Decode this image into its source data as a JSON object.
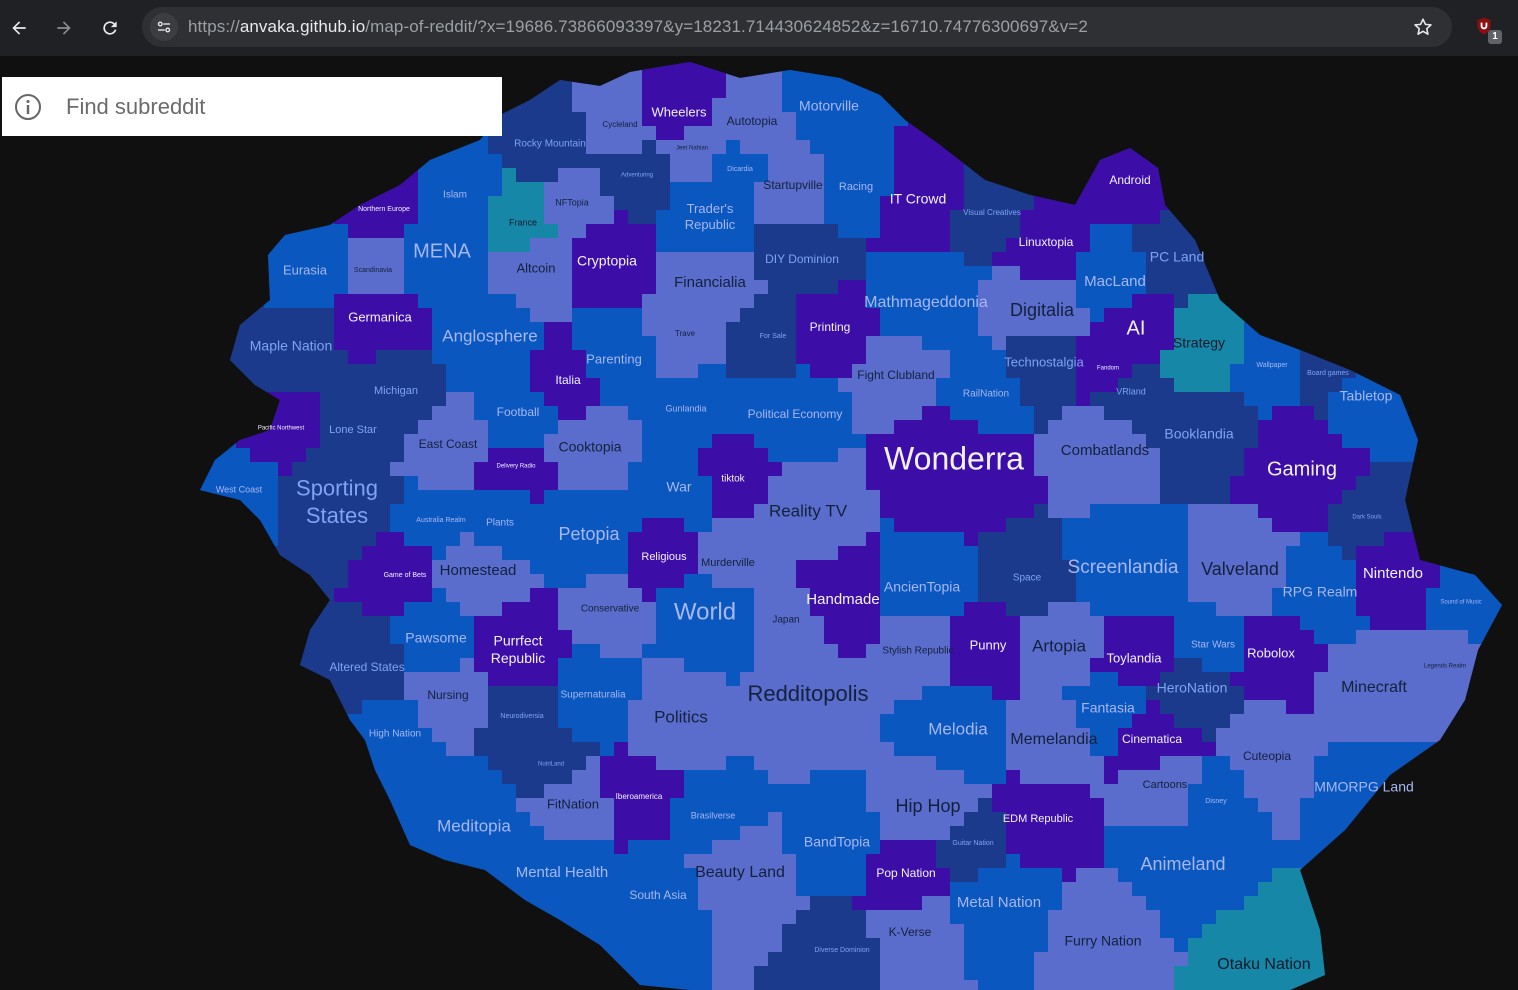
{
  "browser": {
    "url_scheme": "https://",
    "url_host": "anvaka.github.io",
    "url_path": "/map-of-reddit/?x=19686.73866093397&y=18231.714430624852&z=16710.74776300697&v=2",
    "extension_badge": "1",
    "icons": [
      "back-arrow-icon",
      "forward-arrow-icon",
      "reload-icon",
      "site-settings-icon",
      "bookmark-star-icon",
      "ublock-extension-icon"
    ]
  },
  "search": {
    "placeholder": "Find subreddit",
    "icon": "info-icon"
  },
  "colors": {
    "background": "#101010",
    "region_shades": [
      "#1b3a8c",
      "#0b57c0",
      "#5a6dcc",
      "#3d0da8",
      "#1787a8"
    ]
  },
  "regions": [
    {
      "name": "Wheelers"
    },
    {
      "name": "Autotopia"
    },
    {
      "name": "Motorville"
    },
    {
      "name": "Cycleland"
    },
    {
      "name": "Rocky Mountain"
    },
    {
      "name": "Jeet Nahian"
    },
    {
      "name": "Dicardia"
    },
    {
      "name": "Adventuring"
    },
    {
      "name": "Startupville"
    },
    {
      "name": "Racing"
    },
    {
      "name": "IT Crowd"
    },
    {
      "name": "Visual Creatives"
    },
    {
      "name": "Android"
    },
    {
      "name": "Islam"
    },
    {
      "name": "Northern Europe"
    },
    {
      "name": "NFTopia"
    },
    {
      "name": "France"
    },
    {
      "name": "Trader's Republic"
    },
    {
      "name": "MENA"
    },
    {
      "name": "Cryptopia"
    },
    {
      "name": "DIY Dominion"
    },
    {
      "name": "Linuxtopia"
    },
    {
      "name": "PC Land"
    },
    {
      "name": "Eurasia"
    },
    {
      "name": "Scandinavia"
    },
    {
      "name": "Altcoin"
    },
    {
      "name": "Financialia"
    },
    {
      "name": "MacLand"
    },
    {
      "name": "Mathmageddonia"
    },
    {
      "name": "Digitalia"
    },
    {
      "name": "AI"
    },
    {
      "name": "Strategy"
    },
    {
      "name": "Germanica"
    },
    {
      "name": "Anglosphere"
    },
    {
      "name": "Maple Nation"
    },
    {
      "name": "Trave"
    },
    {
      "name": "For Sale"
    },
    {
      "name": "Printing"
    },
    {
      "name": "Parenting"
    },
    {
      "name": "Technostalgia"
    },
    {
      "name": "Fandom"
    },
    {
      "name": "Wallpaper"
    },
    {
      "name": "Board games"
    },
    {
      "name": "Italia"
    },
    {
      "name": "Fight Clubland"
    },
    {
      "name": "RailNation"
    },
    {
      "name": "VRland"
    },
    {
      "name": "Tabletop"
    },
    {
      "name": "Michigan"
    },
    {
      "name": "Gunlandia"
    },
    {
      "name": "Football"
    },
    {
      "name": "Political Economy"
    },
    {
      "name": "Booklandia"
    },
    {
      "name": "Pacific Northwest"
    },
    {
      "name": "Lone Star"
    },
    {
      "name": "East Coast"
    },
    {
      "name": "Cooktopia"
    },
    {
      "name": "Wonderra"
    },
    {
      "name": "Combatlands"
    },
    {
      "name": "Gaming"
    },
    {
      "name": "Delivery Radio"
    },
    {
      "name": "tiktok"
    },
    {
      "name": "War"
    },
    {
      "name": "West Coast"
    },
    {
      "name": "Sporting States"
    },
    {
      "name": "Australia Realm"
    },
    {
      "name": "Plants"
    },
    {
      "name": "Reality TV"
    },
    {
      "name": "Dark Souls"
    },
    {
      "name": "Petopia"
    },
    {
      "name": "Religious"
    },
    {
      "name": "Murderville"
    },
    {
      "name": "Space"
    },
    {
      "name": "Game of Bets"
    },
    {
      "name": "Homestead"
    },
    {
      "name": "Screenlandia"
    },
    {
      "name": "Valveland"
    },
    {
      "name": "Nintendo"
    },
    {
      "name": "AncienTopia"
    },
    {
      "name": "Handmade"
    },
    {
      "name": "RPG Realm"
    },
    {
      "name": "Conservative"
    },
    {
      "name": "World"
    },
    {
      "name": "Japan"
    },
    {
      "name": "Pawsome"
    },
    {
      "name": "Purrfect Republic"
    },
    {
      "name": "Stylish Republic"
    },
    {
      "name": "Punny"
    },
    {
      "name": "Artopia"
    },
    {
      "name": "Toylandia"
    },
    {
      "name": "Star Wars"
    },
    {
      "name": "Robolox"
    },
    {
      "name": "Altered States"
    },
    {
      "name": "Nursing"
    },
    {
      "name": "Supernaturalia"
    },
    {
      "name": "Redditopolis"
    },
    {
      "name": "HeroNation"
    },
    {
      "name": "Fantasia"
    },
    {
      "name": "Minecraft"
    },
    {
      "name": "Politics"
    },
    {
      "name": "Neurodiversia"
    },
    {
      "name": "High Nation"
    },
    {
      "name": "Melodia"
    },
    {
      "name": "Memelandia"
    },
    {
      "name": "Cinematica"
    },
    {
      "name": "Cuteopia"
    },
    {
      "name": "NutriLand"
    },
    {
      "name": "Cartoons"
    },
    {
      "name": "Iberoamerica"
    },
    {
      "name": "FitNation"
    },
    {
      "name": "Brasilverse"
    },
    {
      "name": "Hip Hop"
    },
    {
      "name": "EDM Republic"
    },
    {
      "name": "Disney"
    },
    {
      "name": "MMORPG Land"
    },
    {
      "name": "Meditopia"
    },
    {
      "name": "BandTopia"
    },
    {
      "name": "Guitar Nation"
    },
    {
      "name": "Animeland"
    },
    {
      "name": "Mental Health"
    },
    {
      "name": "Beauty Land"
    },
    {
      "name": "Pop Nation"
    },
    {
      "name": "South Asia"
    },
    {
      "name": "Metal Nation"
    },
    {
      "name": "K-Verse"
    },
    {
      "name": "Diverse Dominion"
    },
    {
      "name": "Furry Nation"
    },
    {
      "name": "Otaku Nation"
    },
    {
      "name": "Legends Realm"
    },
    {
      "name": "Sound of Music"
    }
  ]
}
